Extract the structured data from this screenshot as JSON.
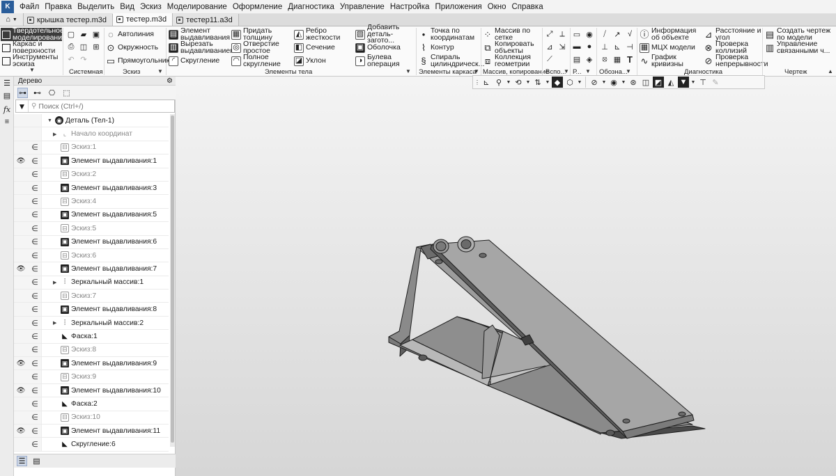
{
  "menu": [
    "Файл",
    "Правка",
    "Выделить",
    "Вид",
    "Эскиз",
    "Моделирование",
    "Оформление",
    "Диагностика",
    "Управление",
    "Настройка",
    "Приложения",
    "Окно",
    "Справка"
  ],
  "tabs": [
    {
      "label": "крышка тестер.m3d",
      "active": false
    },
    {
      "label": "тестер.m3d",
      "active": true
    },
    {
      "label": "тестер11.a3d",
      "active": false
    }
  ],
  "ribbon": {
    "modes": [
      "Твердотельное моделирование",
      "Каркас и поверхности",
      "Инструменты эскиза"
    ],
    "sketch_tools": [
      "Автолиния",
      "Окружность",
      "Прямоугольник"
    ],
    "body_col1": [
      "Элемент выдавливания",
      "Вырезать выдавливанием",
      "Скругление"
    ],
    "body_col2": [
      "Придать толщину",
      "Отверстие простое",
      "Полное скругление"
    ],
    "body_col3": [
      "Ребро жесткости",
      "Сечение",
      "Уклон"
    ],
    "body_col4": [
      "Добавить деталь-загото...",
      "Оболочка",
      "Булева операция"
    ],
    "frame_col": [
      "Точка по координатам",
      "Контур",
      "Спираль цилиндрическ..."
    ],
    "array_col": [
      "Массив по сетке",
      "Копировать объекты",
      "Коллекция геометрии"
    ],
    "diag_col1": [
      "Информация об объекте",
      "МЦХ модели",
      "График кривизны"
    ],
    "diag_col2": [
      "Расстояние и угол",
      "Проверка коллизий",
      "Проверка непрерывности"
    ],
    "drawing_col": [
      "Создать чертеж по модели",
      "Управление связанными ч..."
    ],
    "groups": {
      "system": "Системная",
      "sketch": "Эскиз",
      "body": "Элементы тела",
      "frame": "Элементы каркаса",
      "array": "Массив, копирование",
      "aux": "Вспо...",
      "r": "Р...",
      "notation": "Обозна...",
      "diag": "Диагностика",
      "drawing": "Чертеж"
    }
  },
  "tree": {
    "title": "Дерево",
    "search_placeholder": "Поиск (Ctrl+/)",
    "rows": [
      {
        "label": "Деталь (Тел-1)",
        "type": "part",
        "indent": 2,
        "expand": "down",
        "eye": false,
        "in": false,
        "dim": false
      },
      {
        "label": "Начало координат",
        "type": "origin",
        "indent": 3,
        "expand": "right",
        "eye": false,
        "in": false,
        "dim": true
      },
      {
        "label": "Эскиз:1",
        "type": "sketch",
        "indent": 3,
        "expand": "",
        "eye": false,
        "in": true,
        "dim": true
      },
      {
        "label": "Элемент выдавливания:1",
        "type": "extrude",
        "indent": 3,
        "expand": "",
        "eye": true,
        "in": true,
        "dim": false
      },
      {
        "label": "Эскиз:2",
        "type": "sketch",
        "indent": 3,
        "expand": "",
        "eye": false,
        "in": true,
        "dim": true
      },
      {
        "label": "Элемент выдавливания:3",
        "type": "extrude",
        "indent": 3,
        "expand": "",
        "eye": false,
        "in": true,
        "dim": false
      },
      {
        "label": "Эскиз:4",
        "type": "sketch",
        "indent": 3,
        "expand": "",
        "eye": false,
        "in": true,
        "dim": true
      },
      {
        "label": "Элемент выдавливания:5",
        "type": "extrude",
        "indent": 3,
        "expand": "",
        "eye": false,
        "in": true,
        "dim": false
      },
      {
        "label": "Эскиз:5",
        "type": "sketch",
        "indent": 3,
        "expand": "",
        "eye": false,
        "in": true,
        "dim": true
      },
      {
        "label": "Элемент выдавливания:6",
        "type": "extrude",
        "indent": 3,
        "expand": "",
        "eye": false,
        "in": true,
        "dim": false
      },
      {
        "label": "Эскиз:6",
        "type": "sketch",
        "indent": 3,
        "expand": "",
        "eye": false,
        "in": true,
        "dim": true
      },
      {
        "label": "Элемент выдавливания:7",
        "type": "extrude",
        "indent": 3,
        "expand": "",
        "eye": true,
        "in": true,
        "dim": false
      },
      {
        "label": "Зеркальный массив:1",
        "type": "mirror",
        "indent": 3,
        "expand": "right",
        "eye": false,
        "in": true,
        "dim": false
      },
      {
        "label": "Эскиз:7",
        "type": "sketch",
        "indent": 3,
        "expand": "",
        "eye": false,
        "in": true,
        "dim": true
      },
      {
        "label": "Элемент выдавливания:8",
        "type": "extrude",
        "indent": 3,
        "expand": "",
        "eye": false,
        "in": true,
        "dim": false
      },
      {
        "label": "Зеркальный массив:2",
        "type": "mirror",
        "indent": 3,
        "expand": "right",
        "eye": false,
        "in": true,
        "dim": false
      },
      {
        "label": "Фаска:1",
        "type": "chamfer",
        "indent": 3,
        "expand": "",
        "eye": false,
        "in": true,
        "dim": false
      },
      {
        "label": "Эскиз:8",
        "type": "sketch",
        "indent": 3,
        "expand": "",
        "eye": false,
        "in": true,
        "dim": true
      },
      {
        "label": "Элемент выдавливания:9",
        "type": "extrude",
        "indent": 3,
        "expand": "",
        "eye": true,
        "in": true,
        "dim": false
      },
      {
        "label": "Эскиз:9",
        "type": "sketch",
        "indent": 3,
        "expand": "",
        "eye": false,
        "in": true,
        "dim": true
      },
      {
        "label": "Элемент выдавливания:10",
        "type": "extrude",
        "indent": 3,
        "expand": "",
        "eye": true,
        "in": true,
        "dim": false
      },
      {
        "label": "Фаска:2",
        "type": "chamfer",
        "indent": 3,
        "expand": "",
        "eye": false,
        "in": true,
        "dim": false
      },
      {
        "label": "Эскиз:10",
        "type": "sketch",
        "indent": 3,
        "expand": "",
        "eye": false,
        "in": true,
        "dim": true
      },
      {
        "label": "Элемент выдавливания:11",
        "type": "extrude",
        "indent": 3,
        "expand": "",
        "eye": true,
        "in": true,
        "dim": false
      },
      {
        "label": "Скругление:6",
        "type": "chamfer",
        "indent": 3,
        "expand": "",
        "eye": false,
        "in": true,
        "dim": false
      }
    ]
  },
  "colors": {
    "part_fill_top": "#a9a9a9",
    "part_fill_side": "#7d7d7d",
    "part_fill_dark": "#5e5e5e",
    "part_edge": "#1e1e1e"
  }
}
